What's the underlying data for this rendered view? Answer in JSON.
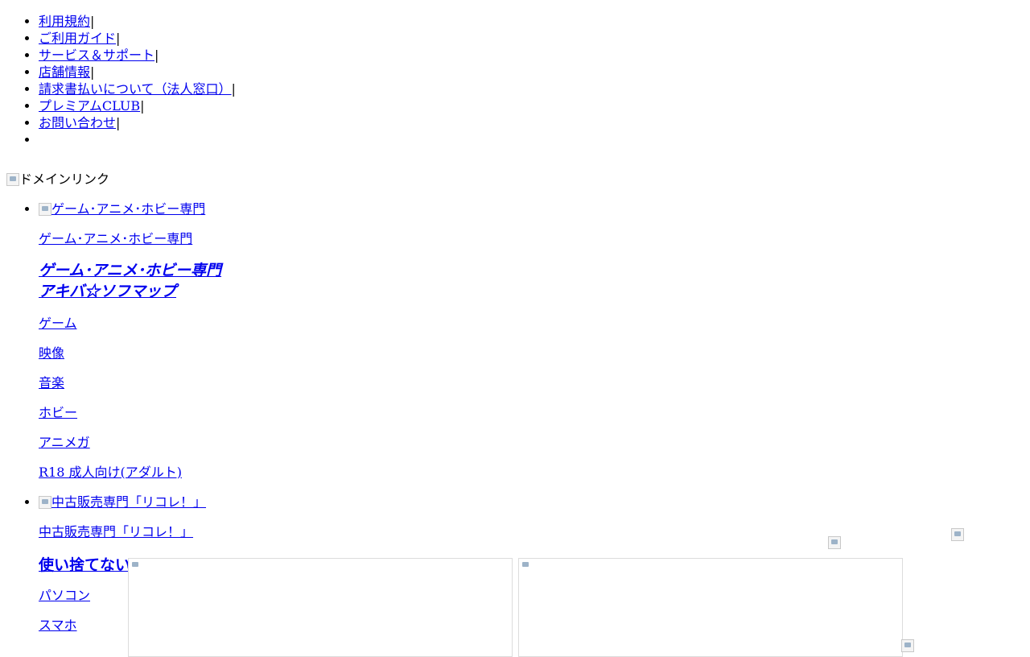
{
  "top_links": [
    {
      "label": "利用規約",
      "sep": "|"
    },
    {
      "label": "ご利用ガイド",
      "sep": "|"
    },
    {
      "label": "サービス＆サポート",
      "sep": "|"
    },
    {
      "label": "店舗情報",
      "sep": "|"
    },
    {
      "label": "請求書払いについて（法人窓口）",
      "sep": "|"
    },
    {
      "label": "プレミアムCLUB",
      "sep": "|"
    },
    {
      "label": "お問い合わせ",
      "sep": "|"
    },
    {
      "label": "",
      "sep": ""
    }
  ],
  "domain_link_alt": "ドメインリンク",
  "domains": [
    {
      "logo_alt": "ゲーム･アニメ･ホビー専門",
      "name": "ゲーム･アニメ･ホビー専門",
      "heading_line1": "ゲーム･アニメ･ホビー専門",
      "heading_line2": "アキバ☆ソフマップ",
      "categories": [
        "ゲーム",
        "映像",
        "音楽",
        "ホビー",
        "アニメガ",
        "R18 成人向け(アダルト)"
      ]
    },
    {
      "logo_alt": "中古販売専門「リコレ！」",
      "name": "中古販売専門「リコレ！」",
      "heading_line1": "使い捨てない",
      "categories": [
        "パソコン",
        "スマホ"
      ]
    }
  ]
}
